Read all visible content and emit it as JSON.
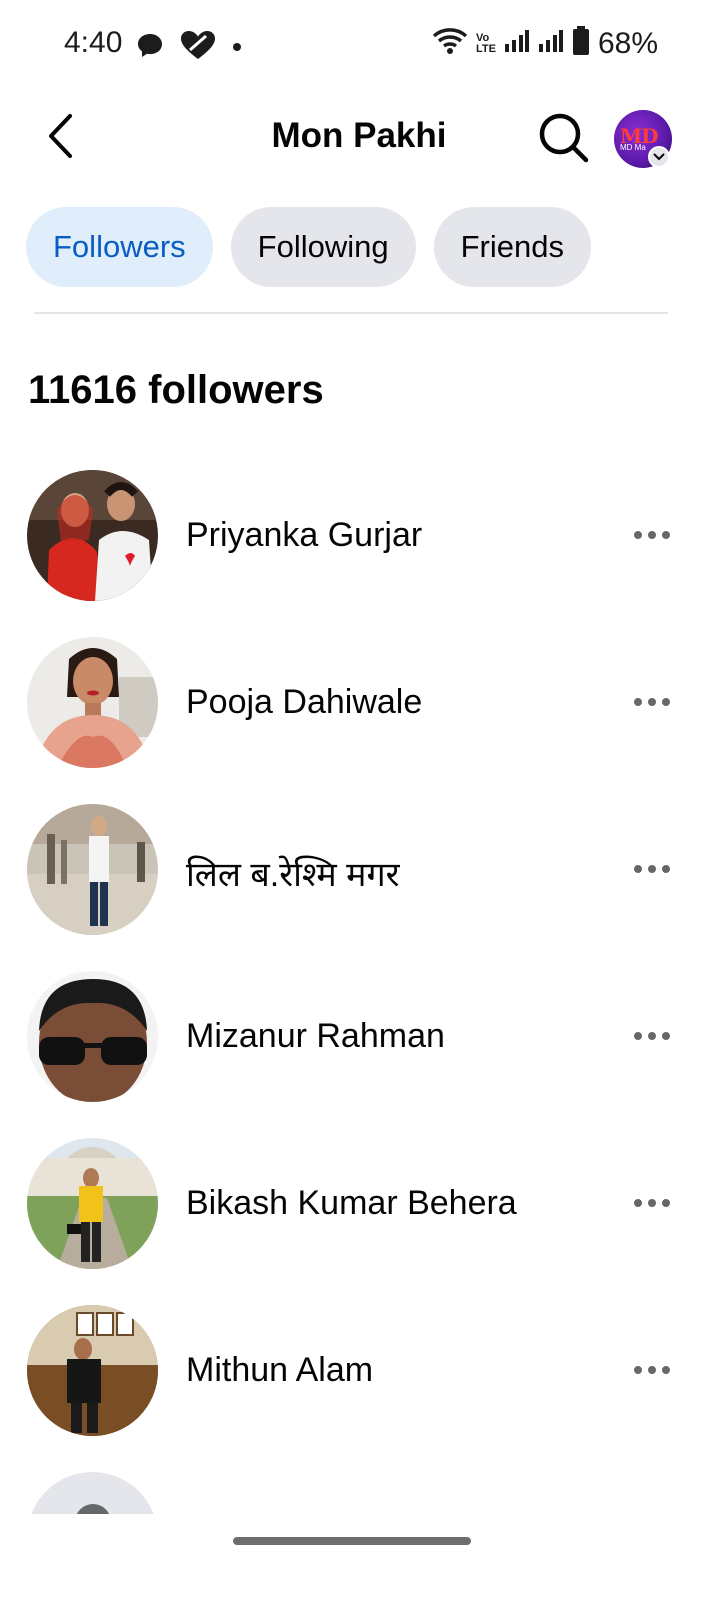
{
  "status_bar": {
    "time": "4:40",
    "battery": "68%",
    "network_label_top": "Vo",
    "network_label_bottom": "LTE"
  },
  "header": {
    "title": "Mon Pakhi",
    "back_icon": "chevron-left-icon",
    "search_icon": "search-icon",
    "avatar_text": "MD",
    "avatar_subtext": "MD Ma"
  },
  "tabs": [
    {
      "label": "Followers",
      "active": true
    },
    {
      "label": "Following",
      "active": false
    },
    {
      "label": "Friends",
      "active": false
    }
  ],
  "followers_count": "11616 followers",
  "followers": [
    {
      "name": "Priyanka Gurjar"
    },
    {
      "name": "Pooja Dahiwale"
    },
    {
      "name": "लिल ब.रेश्मि मगर"
    },
    {
      "name": "Mizanur Rahman"
    },
    {
      "name": "Bikash Kumar Behera"
    },
    {
      "name": "Mithun Alam"
    }
  ],
  "colors": {
    "accent": "#0a5dc2",
    "active_tab_bg": "#e0edfb",
    "tab_bg": "#e4e6eb",
    "text": "#050505",
    "icon_gray": "#65676b"
  }
}
